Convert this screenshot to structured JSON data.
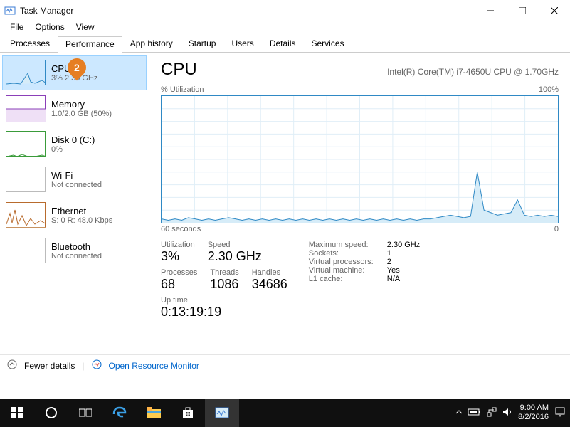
{
  "window": {
    "title": "Task Manager"
  },
  "menu": {
    "file": "File",
    "options": "Options",
    "view": "View"
  },
  "tabs": {
    "processes": "Processes",
    "performance": "Performance",
    "app_history": "App history",
    "startup": "Startup",
    "users": "Users",
    "details": "Details",
    "services": "Services"
  },
  "sidebar": {
    "cpu": {
      "name": "CPU",
      "sub": "3% 2.30 GHz",
      "color": "#2f89c5"
    },
    "memory": {
      "name": "Memory",
      "sub": "1.0/2.0 GB (50%)",
      "color": "#8b3fb8"
    },
    "disk": {
      "name": "Disk 0 (C:)",
      "sub": "0%",
      "color": "#3a9b3a"
    },
    "wifi": {
      "name": "Wi-Fi",
      "sub": "Not connected",
      "color": "#bbb"
    },
    "eth": {
      "name": "Ethernet",
      "sub": "S: 0  R: 48.0 Kbps",
      "color": "#b86b2d"
    },
    "bt": {
      "name": "Bluetooth",
      "sub": "Not connected",
      "color": "#bbb"
    }
  },
  "detail": {
    "title": "CPU",
    "model": "Intel(R) Core(TM) i7-4650U CPU @ 1.70GHz",
    "util_label": "% Utilization",
    "util_max": "100%",
    "x_start": "60 seconds",
    "x_end": "0",
    "stats": {
      "utilization": {
        "lbl": "Utilization",
        "val": "3%"
      },
      "speed": {
        "lbl": "Speed",
        "val": "2.30 GHz"
      },
      "processes": {
        "lbl": "Processes",
        "val": "68"
      },
      "threads": {
        "lbl": "Threads",
        "val": "1086"
      },
      "handles": {
        "lbl": "Handles",
        "val": "34686"
      },
      "uptime": {
        "lbl": "Up time",
        "val": "0:13:19:19"
      }
    },
    "info": {
      "max_speed": {
        "k": "Maximum speed:",
        "v": "2.30 GHz"
      },
      "sockets": {
        "k": "Sockets:",
        "v": "1"
      },
      "vprocs": {
        "k": "Virtual processors:",
        "v": "2"
      },
      "vm": {
        "k": "Virtual machine:",
        "v": "Yes"
      },
      "l1": {
        "k": "L1 cache:",
        "v": "N/A"
      }
    }
  },
  "footer": {
    "fewer": "Fewer details",
    "resmon": "Open Resource Monitor"
  },
  "taskbar": {
    "time": "9:00 AM",
    "date": "8/2/2016"
  },
  "badge": {
    "num": "2"
  },
  "chart_data": {
    "type": "line",
    "title": "CPU % Utilization",
    "xlabel": "seconds",
    "ylabel": "% Utilization",
    "xlim": [
      60,
      0
    ],
    "ylim": [
      0,
      100
    ],
    "series": [
      {
        "name": "CPU",
        "values": [
          3,
          2,
          3,
          2,
          4,
          3,
          2,
          3,
          2,
          3,
          4,
          3,
          2,
          3,
          2,
          3,
          2,
          3,
          2,
          3,
          2,
          3,
          2,
          3,
          2,
          3,
          2,
          3,
          2,
          3,
          2,
          3,
          2,
          3,
          2,
          3,
          2,
          3,
          2,
          3,
          3,
          4,
          5,
          6,
          5,
          4,
          5,
          40,
          10,
          8,
          6,
          7,
          8,
          18,
          6,
          5,
          6,
          5,
          6,
          5
        ]
      }
    ]
  }
}
